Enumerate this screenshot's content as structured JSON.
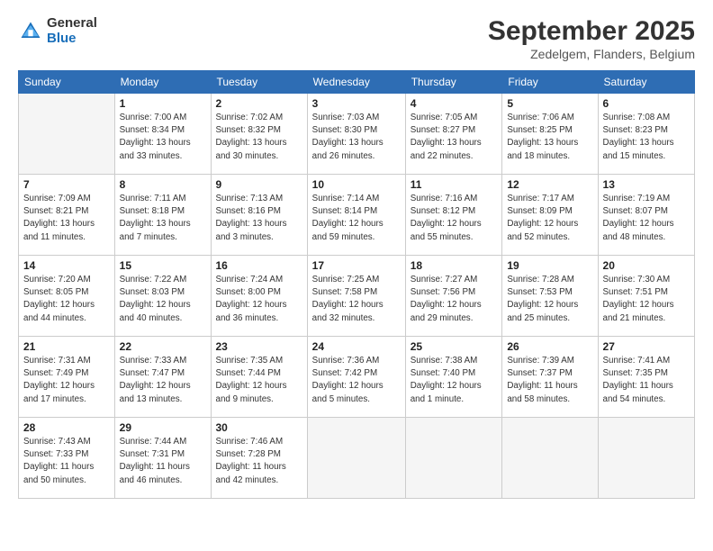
{
  "header": {
    "title": "September 2025",
    "location": "Zedelgem, Flanders, Belgium",
    "logo_general": "General",
    "logo_blue": "Blue"
  },
  "days_of_week": [
    "Sunday",
    "Monday",
    "Tuesday",
    "Wednesday",
    "Thursday",
    "Friday",
    "Saturday"
  ],
  "weeks": [
    [
      {
        "day": "",
        "info": ""
      },
      {
        "day": "1",
        "info": "Sunrise: 7:00 AM\nSunset: 8:34 PM\nDaylight: 13 hours\nand 33 minutes."
      },
      {
        "day": "2",
        "info": "Sunrise: 7:02 AM\nSunset: 8:32 PM\nDaylight: 13 hours\nand 30 minutes."
      },
      {
        "day": "3",
        "info": "Sunrise: 7:03 AM\nSunset: 8:30 PM\nDaylight: 13 hours\nand 26 minutes."
      },
      {
        "day": "4",
        "info": "Sunrise: 7:05 AM\nSunset: 8:27 PM\nDaylight: 13 hours\nand 22 minutes."
      },
      {
        "day": "5",
        "info": "Sunrise: 7:06 AM\nSunset: 8:25 PM\nDaylight: 13 hours\nand 18 minutes."
      },
      {
        "day": "6",
        "info": "Sunrise: 7:08 AM\nSunset: 8:23 PM\nDaylight: 13 hours\nand 15 minutes."
      }
    ],
    [
      {
        "day": "7",
        "info": "Sunrise: 7:09 AM\nSunset: 8:21 PM\nDaylight: 13 hours\nand 11 minutes."
      },
      {
        "day": "8",
        "info": "Sunrise: 7:11 AM\nSunset: 8:18 PM\nDaylight: 13 hours\nand 7 minutes."
      },
      {
        "day": "9",
        "info": "Sunrise: 7:13 AM\nSunset: 8:16 PM\nDaylight: 13 hours\nand 3 minutes."
      },
      {
        "day": "10",
        "info": "Sunrise: 7:14 AM\nSunset: 8:14 PM\nDaylight: 12 hours\nand 59 minutes."
      },
      {
        "day": "11",
        "info": "Sunrise: 7:16 AM\nSunset: 8:12 PM\nDaylight: 12 hours\nand 55 minutes."
      },
      {
        "day": "12",
        "info": "Sunrise: 7:17 AM\nSunset: 8:09 PM\nDaylight: 12 hours\nand 52 minutes."
      },
      {
        "day": "13",
        "info": "Sunrise: 7:19 AM\nSunset: 8:07 PM\nDaylight: 12 hours\nand 48 minutes."
      }
    ],
    [
      {
        "day": "14",
        "info": "Sunrise: 7:20 AM\nSunset: 8:05 PM\nDaylight: 12 hours\nand 44 minutes."
      },
      {
        "day": "15",
        "info": "Sunrise: 7:22 AM\nSunset: 8:03 PM\nDaylight: 12 hours\nand 40 minutes."
      },
      {
        "day": "16",
        "info": "Sunrise: 7:24 AM\nSunset: 8:00 PM\nDaylight: 12 hours\nand 36 minutes."
      },
      {
        "day": "17",
        "info": "Sunrise: 7:25 AM\nSunset: 7:58 PM\nDaylight: 12 hours\nand 32 minutes."
      },
      {
        "day": "18",
        "info": "Sunrise: 7:27 AM\nSunset: 7:56 PM\nDaylight: 12 hours\nand 29 minutes."
      },
      {
        "day": "19",
        "info": "Sunrise: 7:28 AM\nSunset: 7:53 PM\nDaylight: 12 hours\nand 25 minutes."
      },
      {
        "day": "20",
        "info": "Sunrise: 7:30 AM\nSunset: 7:51 PM\nDaylight: 12 hours\nand 21 minutes."
      }
    ],
    [
      {
        "day": "21",
        "info": "Sunrise: 7:31 AM\nSunset: 7:49 PM\nDaylight: 12 hours\nand 17 minutes."
      },
      {
        "day": "22",
        "info": "Sunrise: 7:33 AM\nSunset: 7:47 PM\nDaylight: 12 hours\nand 13 minutes."
      },
      {
        "day": "23",
        "info": "Sunrise: 7:35 AM\nSunset: 7:44 PM\nDaylight: 12 hours\nand 9 minutes."
      },
      {
        "day": "24",
        "info": "Sunrise: 7:36 AM\nSunset: 7:42 PM\nDaylight: 12 hours\nand 5 minutes."
      },
      {
        "day": "25",
        "info": "Sunrise: 7:38 AM\nSunset: 7:40 PM\nDaylight: 12 hours\nand 1 minute."
      },
      {
        "day": "26",
        "info": "Sunrise: 7:39 AM\nSunset: 7:37 PM\nDaylight: 11 hours\nand 58 minutes."
      },
      {
        "day": "27",
        "info": "Sunrise: 7:41 AM\nSunset: 7:35 PM\nDaylight: 11 hours\nand 54 minutes."
      }
    ],
    [
      {
        "day": "28",
        "info": "Sunrise: 7:43 AM\nSunset: 7:33 PM\nDaylight: 11 hours\nand 50 minutes."
      },
      {
        "day": "29",
        "info": "Sunrise: 7:44 AM\nSunset: 7:31 PM\nDaylight: 11 hours\nand 46 minutes."
      },
      {
        "day": "30",
        "info": "Sunrise: 7:46 AM\nSunset: 7:28 PM\nDaylight: 11 hours\nand 42 minutes."
      },
      {
        "day": "",
        "info": ""
      },
      {
        "day": "",
        "info": ""
      },
      {
        "day": "",
        "info": ""
      },
      {
        "day": "",
        "info": ""
      }
    ]
  ]
}
